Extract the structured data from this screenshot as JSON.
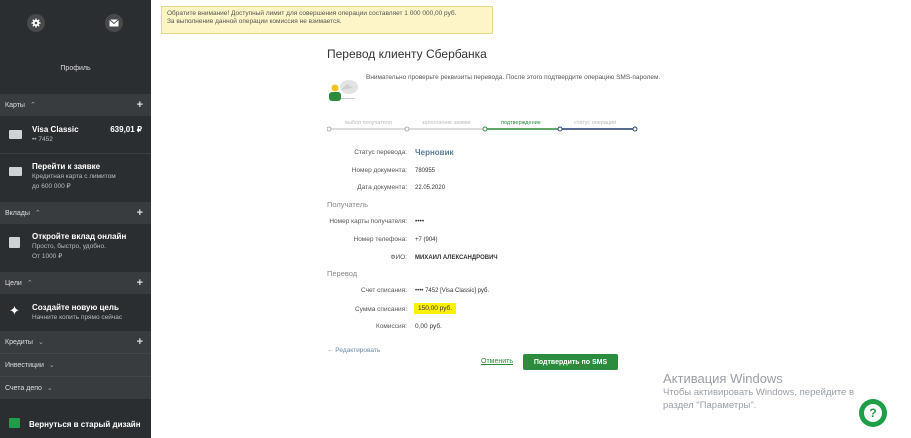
{
  "sidebar": {
    "profile_label": "Профиль",
    "cards": {
      "section": "Карты",
      "visa": {
        "title": "Visa Classic",
        "number": "•• 7452",
        "amount": "639,01 ₽"
      },
      "apply": {
        "title": "Перейти к заявке",
        "line1": "Кредитная карта с лимитом",
        "line2": "до 600 000 ₽"
      }
    },
    "deposits": {
      "section": "Вклады",
      "item": {
        "title": "Откройте вклад онлайн",
        "line1": "Просто, быстро, удобно.",
        "line2": "От 1000 ₽"
      }
    },
    "goals": {
      "section": "Цели",
      "item": {
        "title": "Создайте новую цель",
        "line1": "Начните копить прямо сейчас"
      }
    },
    "credits": "Кредиты",
    "investments": "Инвестиции",
    "depo": "Счета депо",
    "old_design": "Вернуться в старый дизайн"
  },
  "warning": {
    "line1": "Обратите внимание! Доступный лимит для совершения операции составляет 1 000 000,00 руб.",
    "line2": "За выполнение данной операции комиссия не взимается."
  },
  "page": {
    "title": "Перевод клиенту Сбербанка",
    "intro": "Внимательно проверьте реквизиты перевода. После этого подтвердите операцию SMS-паролем."
  },
  "steps": [
    {
      "label": "выбор получателя",
      "state": "done"
    },
    {
      "label": "заполнение заявки",
      "state": "done"
    },
    {
      "label": "подтверждение",
      "state": "active"
    },
    {
      "label": "статус операции",
      "state": "todo"
    }
  ],
  "details": {
    "status_label": "Статус перевода:",
    "status_value": "Черновик",
    "doc_num_label": "Номер документа:",
    "doc_num_value": "780955",
    "doc_date_label": "Дата документа:",
    "doc_date_value": "22.05.2020",
    "recipient_title": "Получатель",
    "card_label": "Номер карты получателя:",
    "card_value": "••••",
    "phone_label": "Номер телефона:",
    "phone_value": "+7 (904)",
    "fio_label": "ФИО:",
    "fio_value": "МИХАИЛ АЛЕКСАНДРОВИЧ",
    "transfer_title": "Перевод",
    "account_label": "Счет списания:",
    "account_value": "•••• 7452 [Visa Classic] руб.",
    "sum_label": "Сумма списания:",
    "sum_value": "150,00 руб.",
    "fee_label": "Комиссия:",
    "fee_value": "0,00 руб."
  },
  "actions": {
    "edit": "← Редактировать",
    "cancel": "Отменить",
    "confirm": "Подтвердить по SMS"
  },
  "activation": {
    "title": "Активация Windows",
    "line1": "Чтобы активировать Windows, перейдите в",
    "line2": "раздел \"Параметры\"."
  },
  "colors": {
    "accent": "#2a8c3c",
    "sidebar": "#2b2e31",
    "highlight": "#ffef00"
  }
}
